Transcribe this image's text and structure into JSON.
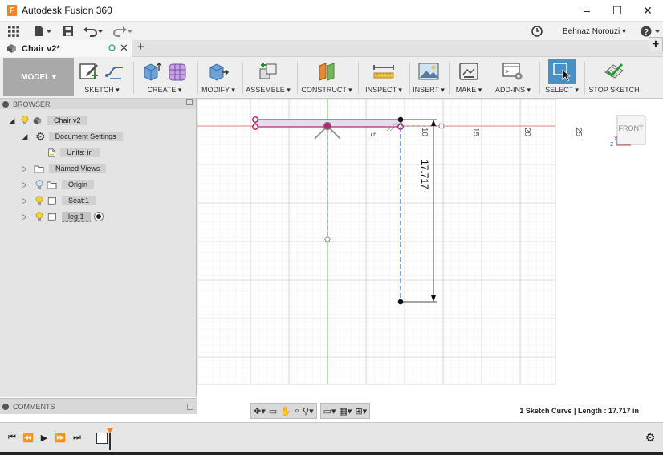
{
  "window": {
    "title": "Autodesk Fusion 360",
    "logo_letter": "F",
    "minimize": "–",
    "maximize": "☐",
    "close": "✕"
  },
  "qat": {
    "user_name": "Behnaz Norouzi ▾",
    "help": "?"
  },
  "document_tab": {
    "label": "Chair v2*",
    "add": "+"
  },
  "ribbon": {
    "workspace": "MODEL ▾",
    "groups": [
      {
        "label": "SKETCH ▾"
      },
      {
        "label": "CREATE ▾"
      },
      {
        "label": "MODIFY ▾"
      },
      {
        "label": "ASSEMBLE ▾"
      },
      {
        "label": "CONSTRUCT ▾"
      },
      {
        "label": "INSPECT ▾"
      },
      {
        "label": "INSERT ▾"
      },
      {
        "label": "MAKE ▾"
      },
      {
        "label": "ADD-INS ▾"
      },
      {
        "label": "SELECT ▾"
      },
      {
        "label": "STOP SKETCH"
      }
    ]
  },
  "browser": {
    "title": "BROWSER",
    "items": [
      {
        "label": "Chair v2"
      },
      {
        "label": "Document Settings"
      },
      {
        "label": "Units: in"
      },
      {
        "label": "Named Views"
      },
      {
        "label": "Origin"
      },
      {
        "label": "Seat:1"
      },
      {
        "label": "leg:1"
      }
    ]
  },
  "comments": {
    "title": "COMMENTS"
  },
  "canvas": {
    "ruler_labels": [
      "5",
      "10",
      "15",
      "20",
      "25"
    ],
    "dimension": "17.717",
    "viewcube_face": "FRONT",
    "axis_z": "Z",
    "axis_x": "X"
  },
  "status": {
    "text": "1 Sketch Curve | Length : 17.717 in"
  },
  "colors": {
    "accent_select": "#4a90c2",
    "sketch_pink": "#b0266f",
    "ribbon_bg": "#eeeeee"
  }
}
